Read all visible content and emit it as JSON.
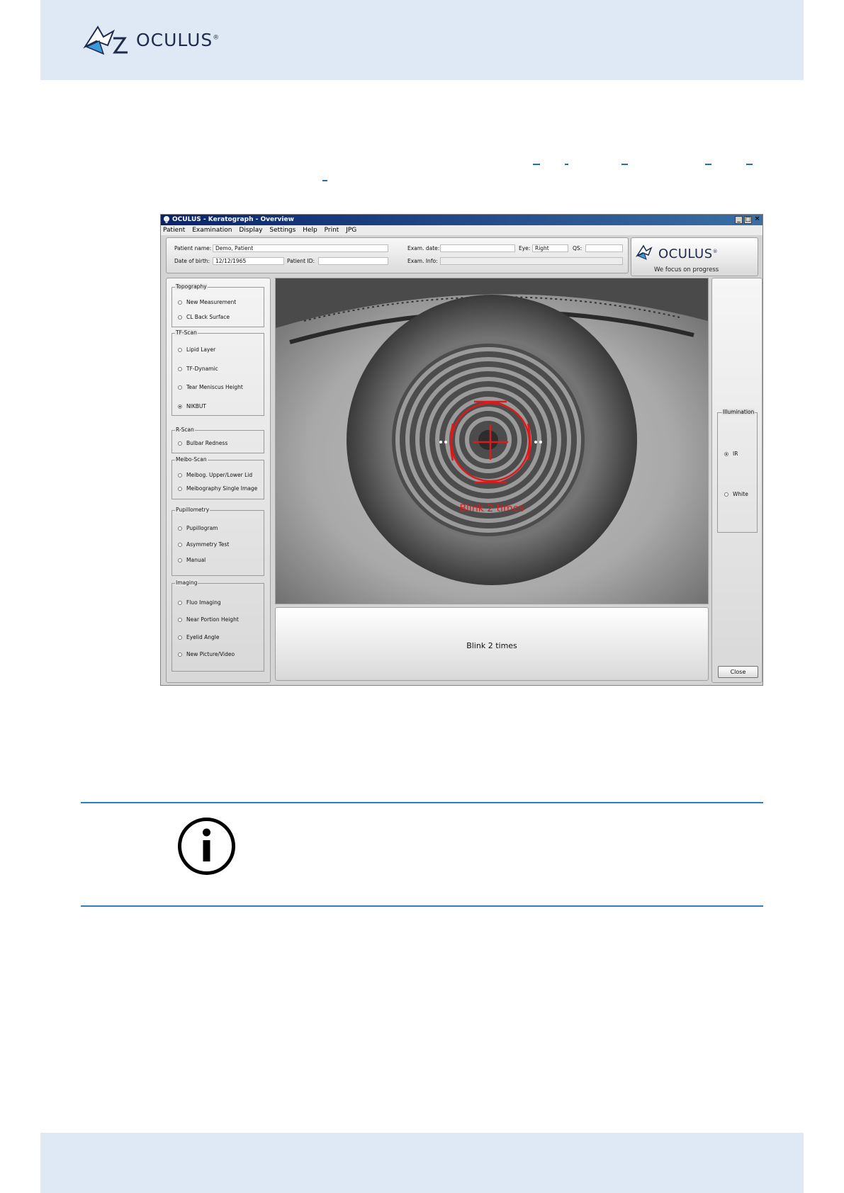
{
  "brand": {
    "name": "OCULUS",
    "reg": "®"
  },
  "app": {
    "window_title": "OCULUS - Keratograph - Overview",
    "menu": [
      "Patient",
      "Examination",
      "Display",
      "Settings",
      "Help",
      "Print",
      "JPG"
    ],
    "patient": {
      "name_label": "Patient name:",
      "name_value": "Demo, Patient",
      "dob_label": "Date of birth:",
      "dob_value": "12/12/1965",
      "id_label": "Patient ID:",
      "id_value": "",
      "exam_date_label": "Exam. date:",
      "exam_date_value": "",
      "eye_label": "Eye:",
      "eye_value": "Right",
      "qs_label": "QS:",
      "qs_value": "",
      "exam_info_label": "Exam. Info:",
      "exam_info_value": ""
    },
    "logo": {
      "name": "OCULUS",
      "reg": "®",
      "tagline": "We focus on progress"
    },
    "groups": [
      {
        "title": "Topography",
        "items": [
          "New Measurement",
          "CL Back Surface"
        ]
      },
      {
        "title": "TF-Scan",
        "items": [
          "Lipid Layer",
          "TF-Dynamic",
          "Tear Meniscus Height",
          "NIKBUT"
        ]
      },
      {
        "title": "R-Scan",
        "items": [
          "Bulbar Redness"
        ]
      },
      {
        "title": "Meibo-Scan",
        "items": [
          "Meibog. Upper/Lower Lid",
          "Meibography Single Image"
        ]
      },
      {
        "title": "Pupillometry",
        "items": [
          "Pupillogram",
          "Asymmetry Test",
          "Manual"
        ]
      },
      {
        "title": "Imaging",
        "items": [
          "Fluo Imaging",
          "Near Portion Height",
          "Eyelid Angle",
          "New Picture/Video"
        ]
      }
    ],
    "selected_mode": "NIKBUT",
    "overlay_text": "Blink 2 times",
    "message": "Blink 2 times",
    "illumination": {
      "title": "Illumination",
      "options": [
        "IR",
        "White"
      ],
      "selected": "IR"
    },
    "close_label": "Close"
  },
  "colors": {
    "header_band": "#dfe9f5",
    "rule": "#2e7fc0",
    "overlay": "#e01818",
    "brand_blue": "#3a9ad9"
  },
  "icons": [
    "oculus-logo-icon",
    "info-icon",
    "app-bulb-icon"
  ]
}
